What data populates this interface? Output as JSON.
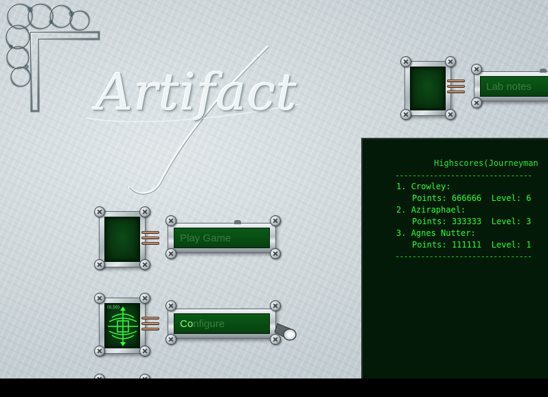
{
  "game": {
    "title": "Artifact"
  },
  "menu": {
    "play_label": "Play Game",
    "configure_label": "Configure",
    "configure_highlight": "Co",
    "configure_rest": "nfigure",
    "lab_notes_label": "Lab notes",
    "config_screen_readout": "(0,50)"
  },
  "highscores": {
    "title": "Highscores(Journeyman",
    "rule": "--------------------------------",
    "entries": [
      {
        "rank": "1.",
        "name": "Crowley:",
        "points_label": "Points:",
        "points": "666666",
        "level_label": "Level:",
        "level": "6"
      },
      {
        "rank": "2.",
        "name": "Aziraphael:",
        "points_label": "Points:",
        "points": "333333",
        "level_label": "Level:",
        "level": "3"
      },
      {
        "rank": "3.",
        "name": "Agnes Nutter:",
        "points_label": "Points:",
        "points": "111111",
        "level_label": "Level:",
        "level": "1"
      }
    ]
  },
  "colors": {
    "screen_green": "#0a5a17",
    "text_green": "#29ff36",
    "dim_label_green": "#3a7e43",
    "highlight_green": "#7cff7a"
  },
  "icons": {
    "corner": "celtic-knot-corner-icon",
    "lamp": "spotlight-icon",
    "radar": "radar-target-icon"
  }
}
